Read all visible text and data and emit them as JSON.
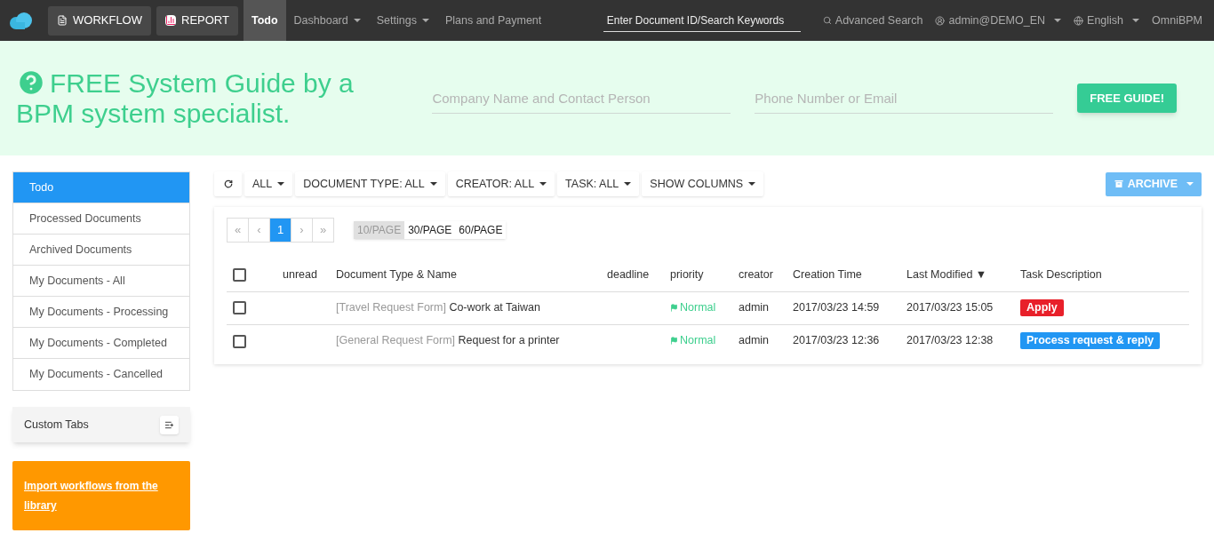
{
  "navbar": {
    "buttons": [
      {
        "label": "WORKFLOW",
        "kind": "file"
      },
      {
        "label": "REPORT",
        "kind": "chart"
      }
    ],
    "items": [
      {
        "label": "Todo",
        "selected": true,
        "dropdown": false
      },
      {
        "label": "Dashboard",
        "selected": false,
        "dropdown": true
      },
      {
        "label": "Settings",
        "selected": false,
        "dropdown": true
      },
      {
        "label": "Plans and Payment",
        "selected": false,
        "dropdown": false
      }
    ],
    "search": {
      "placeholder": "Enter Document ID/Search Keywords"
    },
    "right": [
      {
        "label": "Advanced Search",
        "kind": "search",
        "dropdown": false
      },
      {
        "label": "admin@DEMO_EN",
        "kind": "user",
        "dropdown": true
      },
      {
        "label": "English",
        "kind": "globe",
        "dropdown": true
      },
      {
        "label": "OmniBPM",
        "kind": "none",
        "dropdown": false
      }
    ]
  },
  "banner": {
    "heading": "FREE System Guide by a BPM system specialist.",
    "fields": [
      {
        "placeholder": "Company Name and Contact Person"
      },
      {
        "placeholder": "Phone Number or Email"
      }
    ],
    "button": "FREE GUIDE!"
  },
  "sidebar": {
    "items": [
      {
        "label": "Todo",
        "selected": true
      },
      {
        "label": "Processed Documents",
        "selected": false
      },
      {
        "label": "Archived Documents",
        "selected": false
      },
      {
        "label": "My Documents - All",
        "selected": false
      },
      {
        "label": "My Documents - Processing",
        "selected": false
      },
      {
        "label": "My Documents - Completed",
        "selected": false
      },
      {
        "label": "My Documents - Cancelled",
        "selected": false
      }
    ],
    "custom_tabs": "Custom Tabs",
    "import_link": "Import workflows from the library"
  },
  "toolbar": {
    "filters": [
      "ALL",
      "DOCUMENT TYPE: ALL",
      "CREATOR: ALL",
      "TASK: ALL",
      "SHOW COLUMNS"
    ],
    "archive": "ARCHIVE",
    "archive_disabled": true
  },
  "pagination": {
    "pages": [
      {
        "label": "«",
        "selected": false
      },
      {
        "label": "‹",
        "selected": false
      },
      {
        "label": "1",
        "selected": true
      },
      {
        "label": "›",
        "selected": false
      },
      {
        "label": "»",
        "selected": false
      }
    ],
    "page_sizes": [
      {
        "label": "10/PAGE",
        "selected": true
      },
      {
        "label": "30/PAGE",
        "selected": false
      },
      {
        "label": "60/PAGE",
        "selected": false
      }
    ]
  },
  "table": {
    "select_all_checked": false,
    "columns": [
      "unread",
      "Document Type & Name",
      "deadline",
      "priority",
      "creator",
      "Creation Time",
      "Last Modified ▼",
      "Task Description"
    ],
    "rows": [
      {
        "checked": false,
        "type": "[Travel Request Form]",
        "name": "Co-work at Taiwan",
        "priority": "Normal",
        "creator": "admin",
        "created": "2017/03/23 14:59",
        "modified": "2017/03/23 15:05",
        "task": "Apply",
        "color": "#e8202a"
      },
      {
        "checked": false,
        "type": "[General Request Form]",
        "name": "Request for a printer",
        "priority": "Normal",
        "creator": "admin",
        "created": "2017/03/23 12:36",
        "modified": "2017/03/23 12:38",
        "task": "Process request & reply",
        "color": "#2196f3"
      }
    ]
  }
}
